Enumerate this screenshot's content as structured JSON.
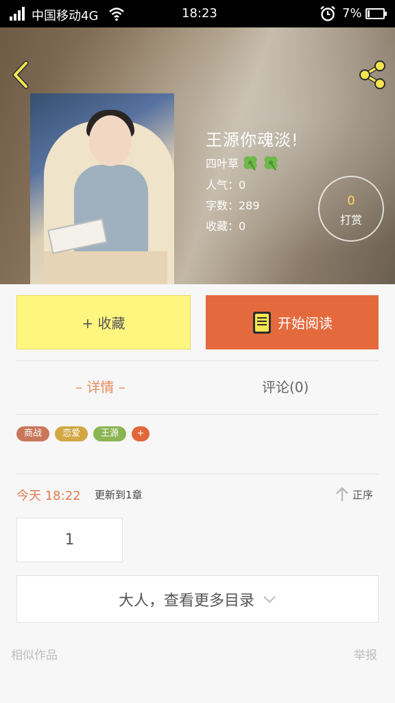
{
  "status_bar": {
    "carrier": "中国移动4G",
    "time": "18:23",
    "battery": "7%"
  },
  "header": {
    "back_icon": "chevron-left-icon",
    "share_icon": "share-icon"
  },
  "book": {
    "title": "王源你魂淡!",
    "grade_label": "四叶草",
    "grade_icon": "clover-icon",
    "grade_count": 2,
    "popularity": "人气：0",
    "word_count": "字数：289",
    "favorites": "收藏：0"
  },
  "reward": {
    "count": "0",
    "label": "打赏"
  },
  "actions": {
    "favorite_label": "+ 收藏",
    "read_label": "开始阅读"
  },
  "tabs": {
    "detail": "– 详情 –",
    "comments": "评论(0)"
  },
  "tags": [
    {
      "label": "商战",
      "color": "#c9775b"
    },
    {
      "label": "恋爱",
      "color": "#d2a744"
    },
    {
      "label": "王源",
      "color": "#8bb552"
    },
    {
      "label": "+",
      "color": "#e2663a"
    }
  ],
  "update": {
    "time": "今天 18:22",
    "text": "更新到1章",
    "sort_label": "正序"
  },
  "chapters": {
    "first": "1",
    "more_label": "大人，查看更多目录"
  },
  "footer": {
    "similar_label": "相似作品",
    "report_label": "举报"
  },
  "colors": {
    "accent_orange": "#e46a3e",
    "favorite_yellow": "#fff680",
    "reward_yellow": "#ffd659"
  }
}
